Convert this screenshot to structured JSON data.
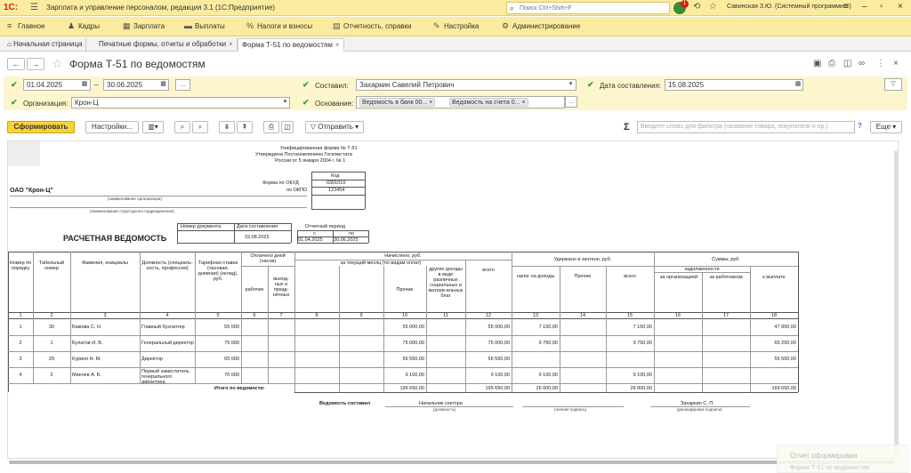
{
  "app": {
    "logo": "1С:",
    "title": "Зарплата и управление персоналом, редакция 3.1  (1С:Предприятие)",
    "search_placeholder": "Поиск Ctrl+Shift+F",
    "notify_count": "1",
    "user": "Савинская З.Ю. (Системный программист)"
  },
  "main_menu": [
    {
      "label": "Главное",
      "icon": "hamburger-icon"
    },
    {
      "label": "Кадры",
      "icon": "people-icon"
    },
    {
      "label": "Зарплата",
      "icon": "calc-icon"
    },
    {
      "label": "Выплаты",
      "icon": "wallet-icon"
    },
    {
      "label": "Налоги и взносы",
      "icon": "percent-icon"
    },
    {
      "label": "Отчетность, справки",
      "icon": "doc-icon"
    },
    {
      "label": "Настройка",
      "icon": "wrench-icon"
    },
    {
      "label": "Администрирование",
      "icon": "gear-icon"
    }
  ],
  "tabs": [
    {
      "label": "Начальная страница"
    },
    {
      "label": "Печатные формы, отчеты и обработки"
    },
    {
      "label": "Форма Т-51 по ведомостям"
    }
  ],
  "form": {
    "title": "Форма Т-51 по ведомостям"
  },
  "params": {
    "date_from": "01.04.2025",
    "dash": "–",
    "date_to": "30.06.2025",
    "more": "...",
    "org_label": "Организация:",
    "org_value": "Крон-Ц",
    "composer_label": "Составил:",
    "composer_value": "Захаркин Савелий Петрович",
    "basis_label": "Основание:",
    "basis_tags": [
      "Ведомость в банк 00...",
      "Ведомость на счета 0..."
    ],
    "date_label": "Дата составления:",
    "date_value": "15.08.2025"
  },
  "toolbar": {
    "generate": "Сформировать",
    "settings": "Настройки...",
    "send": "Отправить",
    "filter_placeholder": "Введите слово для фильтра (название товара, покупателя и пр.)",
    "help": "?",
    "more": "Еще"
  },
  "report": {
    "form_note_1": "Унифицированная форма № Т-51",
    "form_note_2": "Утверждена Постановлением Госкомстата",
    "form_note_3": "России от 5 января 2004 г. № 1",
    "code_label": "Код",
    "okud_label": "Форма по ОКУД",
    "okud_value": "0301010",
    "okpo_label": "по ОКПО",
    "okpo_value": "123454",
    "org_name": "ОАО \"Крон-Ц\"",
    "org_caption": "(наименование организации)",
    "unit_caption": "(наименование структурного подразделения)",
    "doc_num_label": "Номер документа",
    "doc_date_label": "Дата составления",
    "doc_date_value": "15.08.2025",
    "period_label": "Отчетный период",
    "period_from_label": "с",
    "period_to_label": "по",
    "period_from": "01.04.2025",
    "period_to": "30.06.2025",
    "title": "РАСЧЕТНАЯ ВЕДОМОСТЬ",
    "headers": {
      "num": "Номер по порядку",
      "tab_num": "Табельный номер",
      "name": "Фамилия, инициалы",
      "position": "Должность (специаль-ность, профессия)",
      "rate": "Тарифная ставка (часовая, дневная) (оклад), руб.",
      "paid_days": "Оплачено дней (часов)",
      "work": "рабочих",
      "holiday": "выход-ных и празд-ничных",
      "accrued": "Начислено, руб.",
      "accrued_sub": "за текущий месяц (по видам оплат)",
      "other": "Прочие",
      "other_income": "другие доходы в виде различных социальных и матери-альных благ",
      "total": "всего",
      "withheld": "Удержано и зачтено, руб.",
      "tax": "налог на доходы",
      "w_other": "Прочие",
      "w_total": "всего",
      "sums": "Суммы, руб.",
      "debt": "задолженности",
      "debt_org": "за организацией",
      "debt_emp": "за работником",
      "to_pay": "к выплате"
    },
    "col_numbers": [
      "1",
      "2",
      "3",
      "4",
      "5",
      "6",
      "7",
      "8",
      "9",
      "10",
      "11",
      "12",
      "13",
      "14",
      "15",
      "16",
      "17",
      "18"
    ],
    "rows": [
      {
        "n": "1",
        "tab": "30",
        "name": "Бажова С. Н.",
        "pos": "Главный бухгалтер",
        "rate": "55 000",
        "other": "55 000,00",
        "total": "55 000,00",
        "tax": "7 150,00",
        "wtotal": "7 150,00",
        "pay": "47 850,00"
      },
      {
        "n": "2",
        "tab": "1",
        "name": "Булатов И. В.",
        "pos": "Генеральный директор",
        "rate": "75 000",
        "other": "75 000,00",
        "total": "75 000,00",
        "tax": "9 750,00",
        "wtotal": "9 750,00",
        "pay": "65 250,00"
      },
      {
        "n": "3",
        "tab": "29",
        "name": "Куриня Н. М.",
        "pos": "Директор",
        "rate": "65 000",
        "other": "56 550,00",
        "total": "56 550,00",
        "tax": "",
        "wtotal": "",
        "pay": "56 550,00"
      },
      {
        "n": "4",
        "tab": "2",
        "name": "Минчев А. Б.",
        "pos": "Первый заместитель генерального директора",
        "rate": "70 000",
        "other": "9 100,00",
        "total": "9 100,00",
        "tax": "9 100,00",
        "wtotal": "9 100,00",
        "pay": ""
      }
    ],
    "totals_label": "Итого по ведомости:",
    "totals": {
      "other": "195 650,00",
      "total": "195 650,00",
      "tax": "26 000,00",
      "wtotal": "26 000,00",
      "pay": "169 650,00"
    },
    "composed_label": "Ведомость составил",
    "sign_position": "Начальник сектора",
    "sign_name": "Захаркин С. П.",
    "cap_position": "(должность)",
    "cap_sign": "(личная подпись)",
    "cap_name": "(расшифровка подписи)"
  },
  "notification": {
    "title": "Отчет сформирован",
    "subtitle": "Форма Т-51 по ведомостям"
  }
}
